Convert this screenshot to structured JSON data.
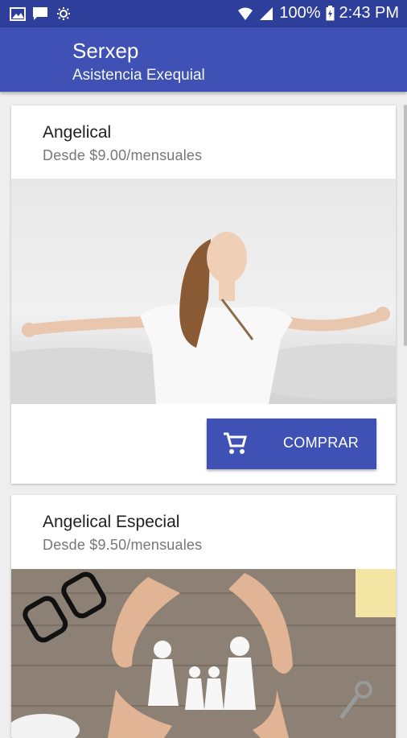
{
  "status_bar": {
    "battery": "100%",
    "time": "2:43 PM"
  },
  "app_bar": {
    "title": "Serxep",
    "subtitle": "Asistencia Exequial"
  },
  "plans": [
    {
      "name": "Angelical",
      "price": "Desde $9.00/mensuales",
      "buy_label": "COMPRAR",
      "image": "woman-arms-outstretched-photo"
    },
    {
      "name": "Angelical Especial",
      "price": "Desde $9.50/mensuales",
      "image": "hands-protecting-paper-family-photo"
    }
  ],
  "colors": {
    "primary": "#3f51b5",
    "primary_dark": "#2d3e9b"
  }
}
